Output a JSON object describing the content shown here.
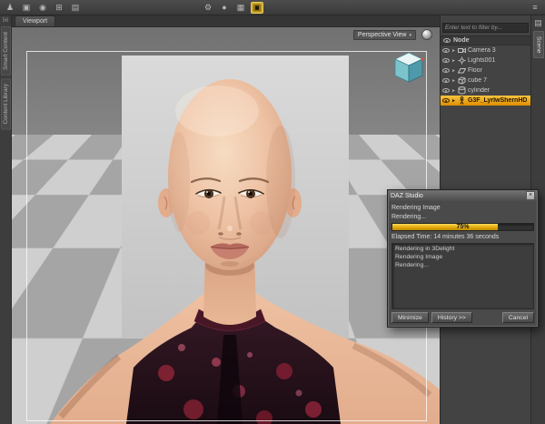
{
  "ui": {
    "caret_collapsed": "►",
    "dropdown_caret": "▾",
    "close_glyph": "×"
  },
  "toolbar": {
    "left_icons": [
      {
        "name": "figure-icon",
        "glyph": "♟"
      },
      {
        "name": "wardrobe-icon",
        "glyph": "▣"
      },
      {
        "name": "hair-icon",
        "glyph": "◉"
      },
      {
        "name": "pose-icon",
        "glyph": "⊞"
      },
      {
        "name": "props-icon",
        "glyph": "▤"
      }
    ],
    "center_icons": [
      {
        "name": "gear-icon",
        "glyph": "⚙"
      },
      {
        "name": "sphere-icon",
        "glyph": "●"
      },
      {
        "name": "content-icon",
        "glyph": "▦"
      },
      {
        "name": "render-icon",
        "glyph": "▣"
      }
    ],
    "right_icons": [
      {
        "name": "panel-menu-icon",
        "glyph": "≡"
      }
    ]
  },
  "left_dock": {
    "badge": "56",
    "tabs": [
      {
        "label": "Smart Content"
      },
      {
        "label": "Content Library"
      }
    ]
  },
  "right_dock": {
    "icon_glyph": "▤",
    "tabs": [
      {
        "label": "Scene"
      }
    ]
  },
  "viewport": {
    "tab_label": "Viewport",
    "view_selector": {
      "label": "Perspective View"
    }
  },
  "scene_panel": {
    "filter_placeholder": "Enter text to filter by...",
    "column_header": "Node",
    "rows": [
      {
        "label": "Camera 3",
        "icon": "camera-icon",
        "selected": false
      },
      {
        "label": "Lights001",
        "icon": "light-icon",
        "selected": false
      },
      {
        "label": "Floor",
        "icon": "plane-icon",
        "selected": false
      },
      {
        "label": "cube 7",
        "icon": "cube-icon",
        "selected": false
      },
      {
        "label": "cylinder",
        "icon": "cylinder-icon",
        "selected": false
      },
      {
        "label": "G3F_LyrIwShernHD",
        "icon": "figure-icon",
        "selected": true
      }
    ]
  },
  "dialog": {
    "title": "DAZ Studio",
    "heading": "Rendering Image",
    "status": "Rendering...",
    "progress_label": "75%",
    "progress_value": 75,
    "elapsed": "Elapsed Time:  14 minutes 36 seconds",
    "log": [
      "Rendering in 3Delight",
      "Rendering Image",
      "Rendering..."
    ],
    "buttons": {
      "minimize": "Minimize",
      "history": "History >>",
      "cancel": "Cancel"
    }
  }
}
